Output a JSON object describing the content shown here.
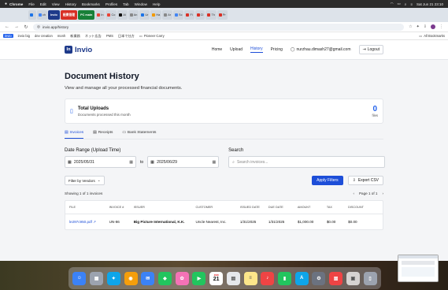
{
  "menubar": {
    "app": "Chrome",
    "items": [
      "File",
      "Edit",
      "View",
      "History",
      "Bookmarks",
      "Profiles",
      "Tab",
      "Window",
      "Help"
    ],
    "datetime": "Sat Jun 21  23:10"
  },
  "tabs": [
    {
      "label": "",
      "color": "#1a73e8"
    },
    {
      "label": "ch",
      "color": "#4285f4"
    },
    {
      "label": "Invio",
      "color": "#1e3a8a",
      "badge": true
    },
    {
      "label": "経費管理",
      "color": "#d93025",
      "badge": true
    },
    {
      "label": "PC main",
      "color": "#188038",
      "badge": true
    },
    {
      "label": "In",
      "color": "#ea4335"
    },
    {
      "label": "Co",
      "color": "#ea4335"
    },
    {
      "label": "Al",
      "color": "#111"
    },
    {
      "label": "An",
      "color": "#888"
    },
    {
      "label": "Ur",
      "color": "#1a73e8"
    },
    {
      "label": "Ha",
      "color": "#f29900"
    },
    {
      "label": "Ar",
      "color": "#888"
    },
    {
      "label": "Sc",
      "color": "#4285f4"
    },
    {
      "label": "Fi",
      "color": "#d93025"
    },
    {
      "label": "CI",
      "color": "#d93025"
    },
    {
      "label": "Th",
      "color": "#d93025"
    },
    {
      "label": "Pr",
      "color": "#d93025"
    }
  ],
  "toolbar": {
    "url": "invio.app/history"
  },
  "bookmarks": [
    {
      "label": "invio",
      "pill": true
    },
    {
      "label": "invio big",
      "pill": false
    },
    {
      "label": "dev creation",
      "pill": false
    },
    {
      "label": "monh",
      "pill": false
    },
    {
      "label": "新業務",
      "pill": false
    },
    {
      "label": "ネット広告",
      "pill": false
    },
    {
      "label": "PMS",
      "pill": false
    },
    {
      "label": "日本で仕方",
      "pill": false
    },
    {
      "label": "Pioneer Carry",
      "pill": false
    }
  ],
  "bookmarks_all": "All Bookmarks",
  "app": {
    "brand": "Invio",
    "nav": [
      "Home",
      "Upload",
      "History",
      "Pricing"
    ],
    "user_email": "nurzhau.dimash27@gmail.com",
    "logout": "Logout"
  },
  "page": {
    "title": "Document History",
    "subtitle": "View and manage all your processed financial documents."
  },
  "summary": {
    "title": "Total Uploads",
    "subtitle": "Documents processed this month",
    "count": "0",
    "unit": "files"
  },
  "doc_tabs": [
    "Invoices",
    "Receipts",
    "Bank Statements"
  ],
  "filters": {
    "date_label": "Date Range (Upload Time)",
    "date_from": "2025/05/31",
    "to_label": "to",
    "date_to": "2025/06/29",
    "search_label": "Search",
    "search_placeholder": "Search invoices..."
  },
  "actions": {
    "vendors": "Filter by Vendors",
    "apply": "Apply Filters",
    "export": "Export CSV"
  },
  "results": {
    "showing": "Showing 1 of 1 invoices",
    "page": "Page 1 of 1"
  },
  "table": {
    "headers": [
      "FILE",
      "INVOICE #",
      "ISSUER",
      "CUSTOMER",
      "ISSUED DATE",
      "DUE DATE",
      "AMOUNT",
      "TAX",
      "DISCOUNT"
    ],
    "rows": [
      [
        "le297c950.pdf",
        "UN-86",
        "Big Picture International, K.K.",
        "Uncle Nearest, Inc.",
        "1/31/2025",
        "1/31/2025",
        "$1,000.00",
        "$0.00",
        "$0.00"
      ]
    ]
  },
  "calendar_day": "21",
  "calendar_month": "JUN"
}
